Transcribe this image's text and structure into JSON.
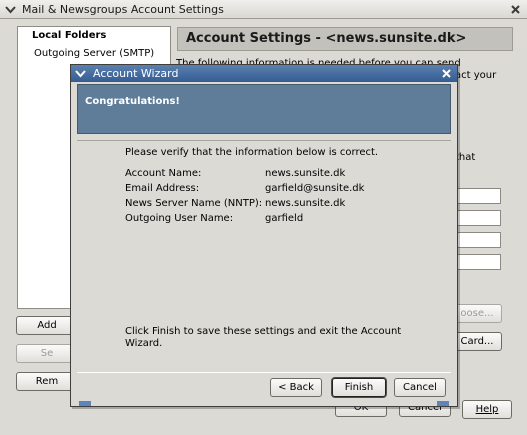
{
  "background_window": {
    "title": "Mail & Newsgroups Account Settings",
    "account_tree": {
      "items": [
        {
          "label": "Local Folders"
        },
        {
          "label": "Outgoing Server (SMTP)"
        }
      ]
    },
    "buttons": {
      "add_account": "Add",
      "set_default": "Se",
      "remove_account": "Rem",
      "choose": "oose...",
      "card": "Card...",
      "ok": "OK",
      "cancel": "Cancel",
      "help": "Help"
    },
    "settings_header": "Account Settings - <news.sunsite.dk>",
    "settings_info": "The following information is needed before you can send messages.",
    "settings_info_tail_1": "act your",
    "settings_info_tail_2": "that"
  },
  "wizard": {
    "title": "Account Wizard",
    "heading": "Congratulations!",
    "verify_text": "Please verify that the information below is correct.",
    "summary": [
      {
        "label": "Account Name:",
        "value": "news.sunsite.dk"
      },
      {
        "label": "Email Address:",
        "value": "garfield@sunsite.dk"
      },
      {
        "label": "News Server Name (NNTP):",
        "value": "news.sunsite.dk"
      },
      {
        "label": "Outgoing User Name:",
        "value": "garfield"
      }
    ],
    "finish_note": "Click Finish to save these settings and exit the Account Wizard.",
    "buttons": {
      "back": "< Back",
      "finish": "Finish",
      "cancel": "Cancel"
    }
  },
  "icons": {
    "window_menu": "chevron-down-icon",
    "window_close": "close-icon"
  },
  "colors": {
    "dialog_titlebar": "#3b6296",
    "banner": "#5f7d99",
    "window_bg": "#dcdad5"
  }
}
